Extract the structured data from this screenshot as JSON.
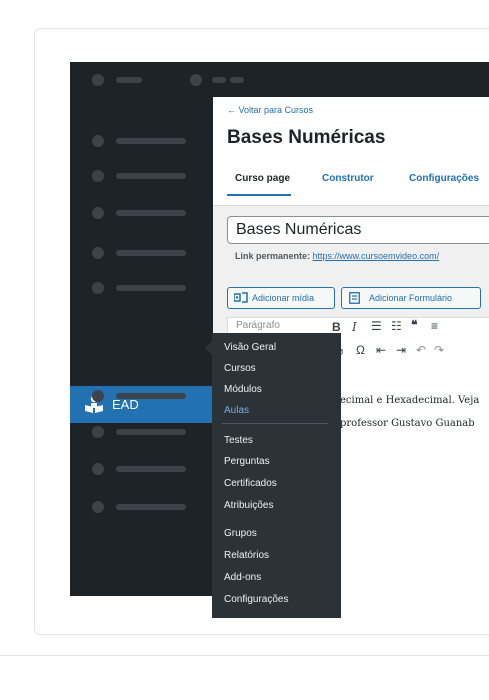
{
  "editor": {
    "back_link": "← Voltar para Cursos",
    "course_title": "Bases Numéricas",
    "tabs": [
      {
        "label": "Curso page"
      },
      {
        "label": "Construtor"
      },
      {
        "label": "Configurações"
      }
    ],
    "title_value": "Bases Numéricas",
    "permalink_label": "Link permanente:",
    "permalink_url": "https://www.cursoemvideo.com/",
    "add_media_label": "Adicionar mídia",
    "add_form_label": "Adicionar Formulário",
    "paragraph_select": "Parágrafo",
    "content_lines": [
      "ecimal e Hexadecimal. Veja",
      "professor Gustavo Guanab"
    ]
  },
  "sidebar": {
    "ead_label": "EAD"
  },
  "flyout": {
    "groups": [
      [
        "Visão Geral",
        "Cursos",
        "Módulos",
        "Aulas"
      ],
      [
        "Testes",
        "Perguntas",
        "Certificados",
        "Atribuições"
      ],
      [
        "Grupos",
        "Relatórios",
        "Add-ons",
        "Configurações"
      ]
    ],
    "active": "Aulas"
  },
  "colors": {
    "admin_bg": "#1d2327",
    "accent": "#2271b1",
    "flyout_bg": "#2c3338",
    "active_item": "#72aee6"
  }
}
